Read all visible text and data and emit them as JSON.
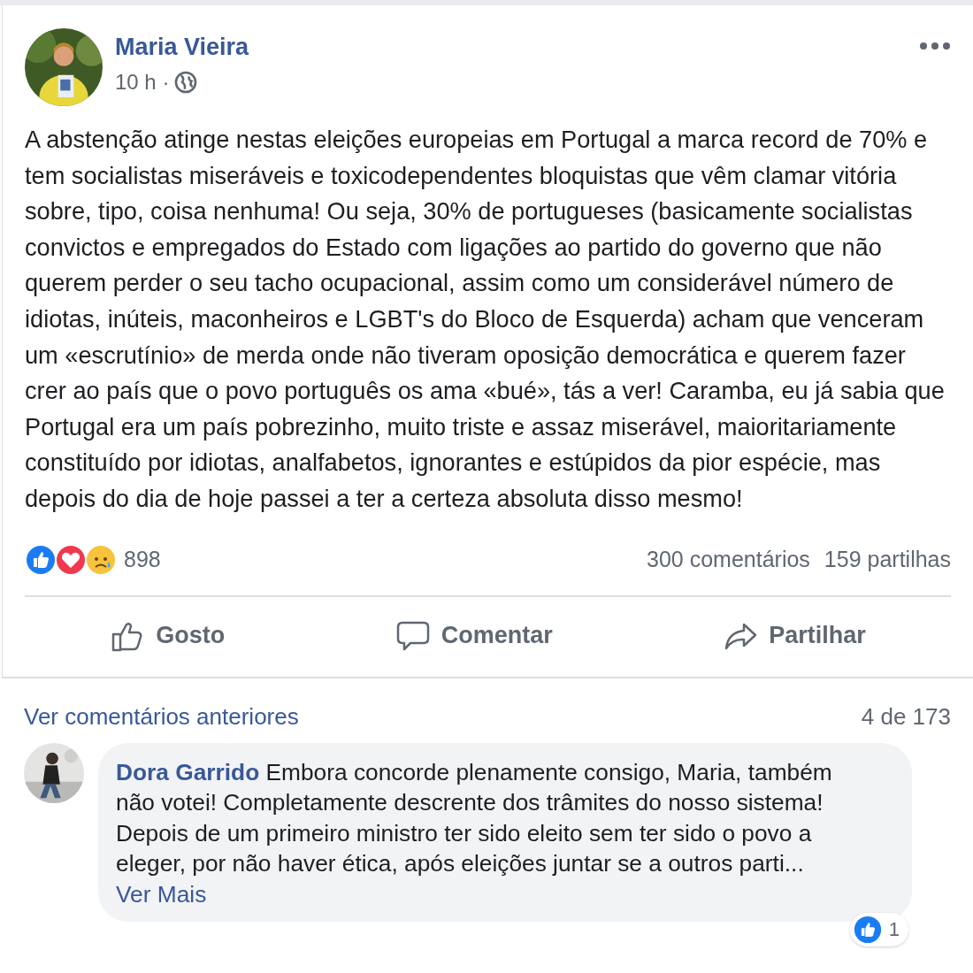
{
  "post": {
    "author": "Maria Vieira",
    "time": "10 h ·",
    "text": "A abstenção atinge nestas eleições europeias em Portugal a marca record de 70% e tem socialistas miseráveis e toxicodependentes bloquistas que vêm clamar vitória sobre, tipo, coisa nenhuma! Ou seja, 30% de portugueses (basicamente socialistas convictos e empregados do Estado com ligações ao partido do governo que não querem perder o seu tacho ocupacional, assim como um considerável número de idiotas, inúteis, maconheiros e LGBT's do Bloco de Esquerda) acham que venceram um «escrutínio» de merda onde não tiveram oposição democrática e querem fazer crer ao país que o povo português os ama «bué», tás a ver! Caramba, eu já sabia que Portugal era um país pobrezinho, muito triste e assaz miserável, maioritariamente constituído por idiotas, analfabetos, ignorantes e estúpidos da pior espécie, mas depois do dia de hoje passei a ter a certeza absoluta disso mesmo!",
    "reactions": [
      {
        "kind": "like"
      },
      {
        "kind": "love"
      },
      {
        "kind": "sad"
      }
    ],
    "reaction_count": "898",
    "comments_count": "300 comentários",
    "shares_count": "159 partilhas"
  },
  "actions": [
    {
      "kind": "like",
      "label": "Gosto"
    },
    {
      "kind": "comment",
      "label": "Comentar"
    },
    {
      "kind": "share",
      "label": "Partilhar"
    }
  ],
  "comments": {
    "previous_link": "Ver comentários anteriores",
    "counter": "4 de 173",
    "items": [
      {
        "author": "Dora Garrido",
        "text": "Embora concorde plenamente consigo, Maria, também não votei! Completamente descrente dos trâmites do nosso sistema! Depois de um primeiro ministro ter sido eleito sem ter sido o povo a eleger, por não haver ética, após eleições juntar se a outros parti...",
        "more": "Ver Mais",
        "like_count": "1"
      }
    ]
  }
}
